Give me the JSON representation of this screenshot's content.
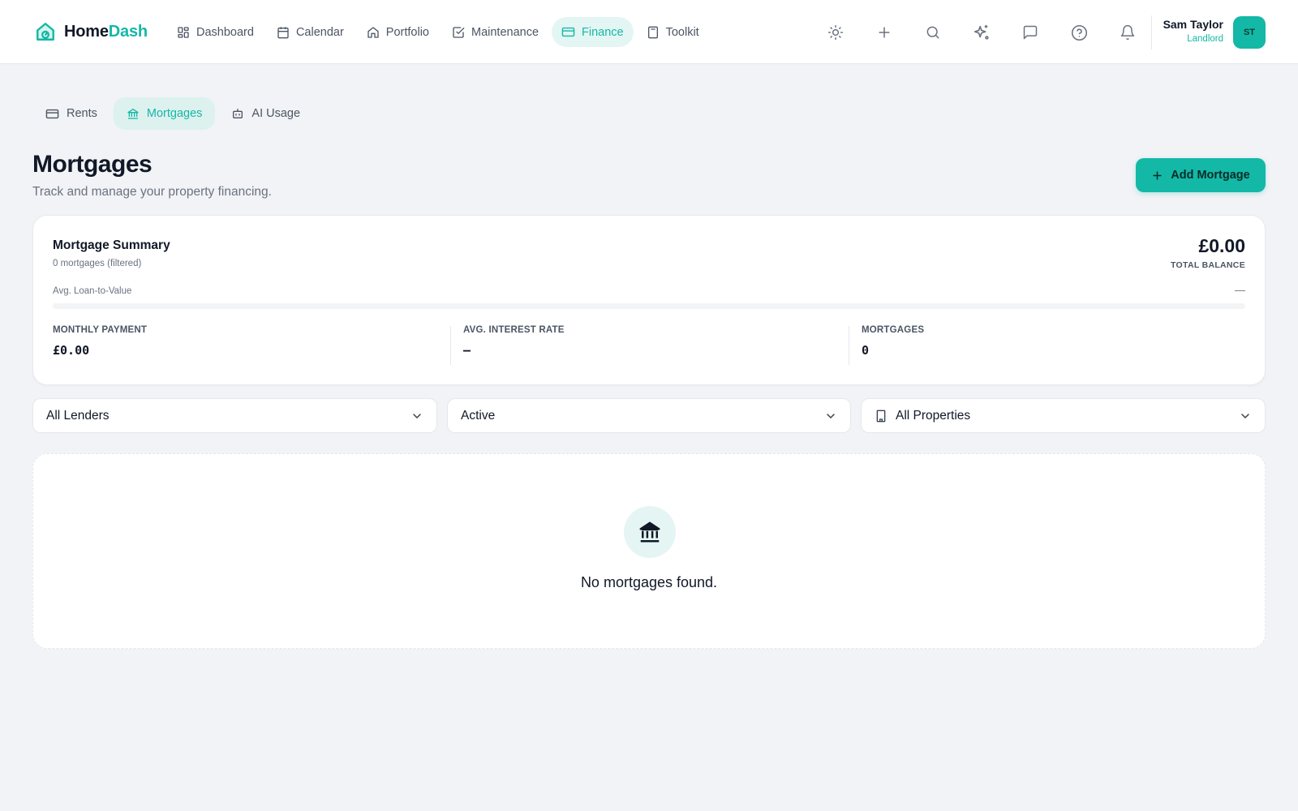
{
  "app": {
    "brand_part1": "Home",
    "brand_part2": "Dash",
    "accent_color": "#14b8a6",
    "logo_icon": "house-logo-icon"
  },
  "nav": {
    "items": [
      {
        "label": "Dashboard",
        "icon": "grid-icon",
        "active": false
      },
      {
        "label": "Calendar",
        "icon": "calendar-icon",
        "active": false
      },
      {
        "label": "Portfolio",
        "icon": "home-icon",
        "active": false
      },
      {
        "label": "Maintenance",
        "icon": "checkbox-icon",
        "active": false
      },
      {
        "label": "Finance",
        "icon": "credit-card-icon",
        "active": true
      },
      {
        "label": "Toolkit",
        "icon": "calculator-icon",
        "active": false
      }
    ]
  },
  "toolbar_icons": [
    "sun-icon",
    "plus-icon",
    "search-icon",
    "sparkles-icon",
    "message-icon",
    "help-icon",
    "bell-icon"
  ],
  "user": {
    "name": "Sam Taylor",
    "role": "Landlord",
    "initials": "ST"
  },
  "subtabs": [
    {
      "label": "Rents",
      "icon": "credit-card-icon",
      "active": false
    },
    {
      "label": "Mortgages",
      "icon": "bank-icon",
      "active": true
    },
    {
      "label": "AI Usage",
      "icon": "bot-icon",
      "active": false
    }
  ],
  "page": {
    "title": "Mortgages",
    "subtitle": "Track and manage your property financing.",
    "add_button": "Add Mortgage"
  },
  "summary": {
    "title": "Mortgage Summary",
    "subtitle": "0 mortgages (filtered)",
    "total_balance": "£0.00",
    "total_balance_label": "TOTAL BALANCE",
    "ltv_label": "Avg. Loan-to-Value",
    "ltv_value": "—",
    "ltv_fraction": 0,
    "stats": [
      {
        "label": "MONTHLY PAYMENT",
        "value": "£0.00"
      },
      {
        "label": "AVG. INTEREST RATE",
        "value": "—"
      },
      {
        "label": "MORTGAGES",
        "value": "0"
      }
    ]
  },
  "filters": {
    "lender": "All Lenders",
    "status": "Active",
    "property": "All Properties"
  },
  "empty_state": {
    "message": "No mortgages found."
  }
}
